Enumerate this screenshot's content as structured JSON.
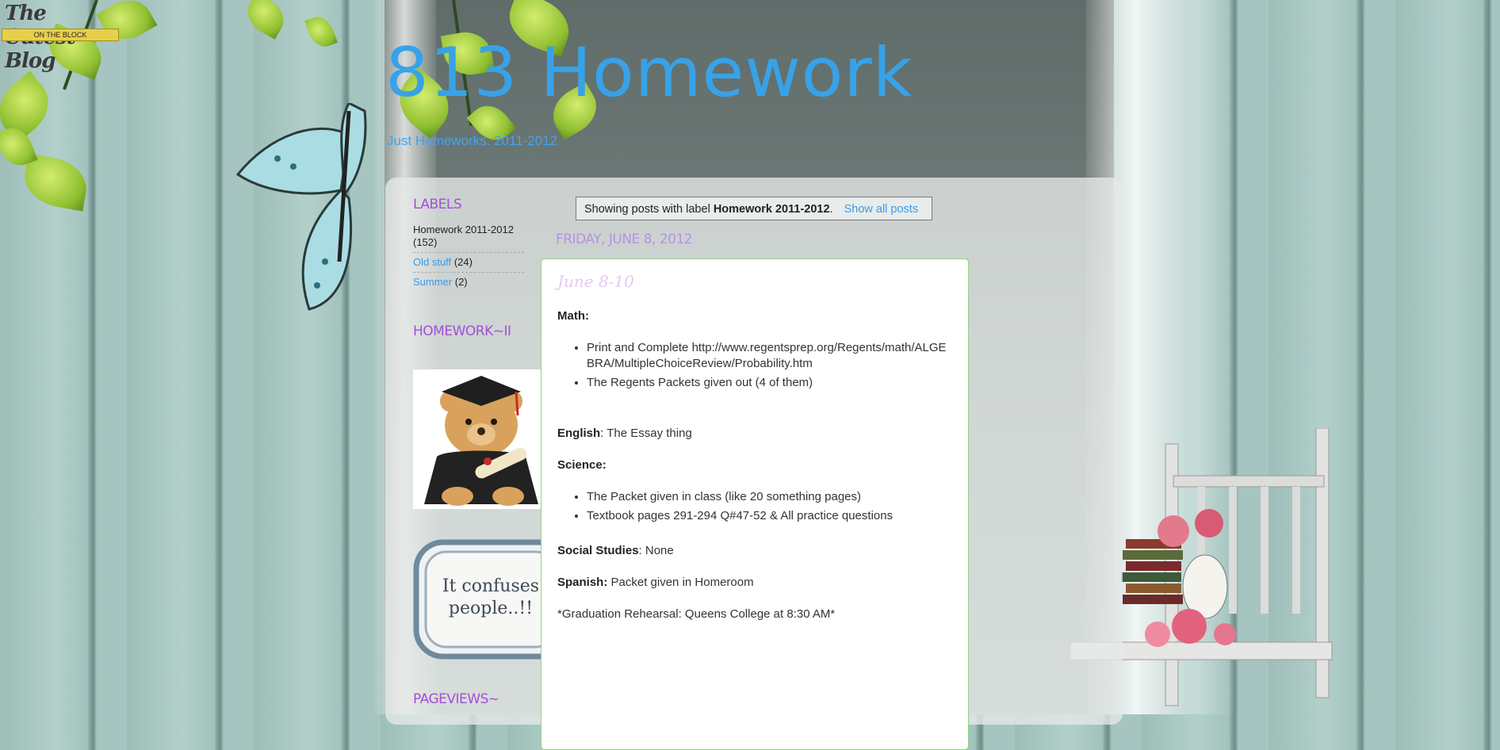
{
  "badge": {
    "name": "The Cutest Blog",
    "tagline": "ON THE BLOCK"
  },
  "header": {
    "title": "813 Homework",
    "description": "Just Homeworks. 2011-2012"
  },
  "sidebar": {
    "labels_title": "LABELS",
    "labels": [
      {
        "name": "Homework 2011-2012",
        "count": "(152)",
        "active": true
      },
      {
        "name": "Old stuff",
        "count": "(24)",
        "active": false
      },
      {
        "name": "Summer",
        "count": "(2)",
        "active": false
      }
    ],
    "homework_title": "HOMEWORK~II",
    "confuses_text_line1": "It confuses",
    "confuses_text_line2": "people..!!",
    "pageviews_title": "PAGEVIEWS~"
  },
  "status": {
    "prefix": "Showing posts with label ",
    "label": "Homework 2011-2012",
    "period": ".",
    "show_all": "Show all posts"
  },
  "date_header": "FRIDAY, JUNE 8, 2012",
  "post": {
    "title": "June 8-10",
    "math_label": "Math:",
    "math_items": [
      "Print and Complete http://www.regentsprep.org/Regents/math/ALGEBRA/MultipleChoiceReview/Probability.htm",
      "The Regents Packets given out (4 of them)"
    ],
    "english_label": "English",
    "english_text": ": The Essay thing",
    "science_label": "Science:",
    "science_items": [
      "The Packet given in class (like 20 something pages)",
      "Textbook pages 291-294 Q#47-52 & All practice questions"
    ],
    "social_label": "Social Studies",
    "social_text": ": None",
    "spanish_label": "Spanish:",
    "spanish_text": " Packet given in Homeroom",
    "graduation_text": "*Graduation Rehearsal: Queens College at 8:30 AM*"
  },
  "colors": {
    "title_blue": "#38a2e8",
    "widget_purple": "#a44fd6",
    "link_blue": "#3b9be8",
    "post_border": "#93d37f"
  }
}
